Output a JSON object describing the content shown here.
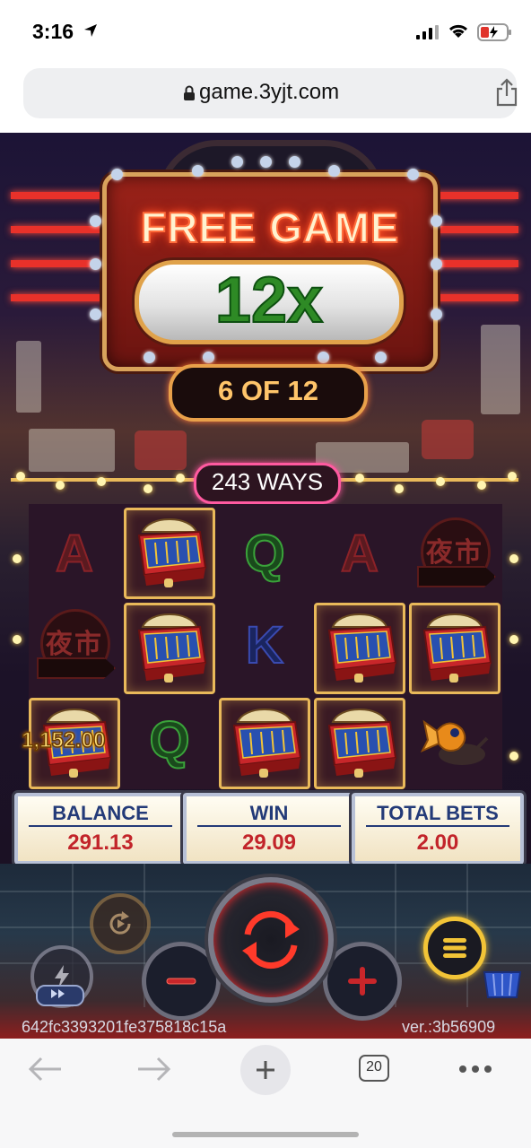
{
  "status_bar": {
    "time": "3:16",
    "icons": [
      "location-arrow-icon",
      "cellular-signal-icon",
      "wifi-icon",
      "battery-charging-icon"
    ]
  },
  "browser": {
    "url": "game.3yjt.com",
    "icons": [
      "lock-icon",
      "share-icon"
    ],
    "toolbar": {
      "tab_count": "20",
      "icons": [
        "back-arrow-icon",
        "forward-arrow-icon",
        "plus-icon",
        "tabs-icon",
        "more-icon"
      ]
    }
  },
  "game": {
    "banner_title": "FREE GAME",
    "multiplier": "12x",
    "round_progress": "6 OF 12",
    "ways": "243 WAYS",
    "reels": [
      [
        "A",
        "night-market",
        "pinball"
      ],
      [
        "pinball",
        "pinball",
        "Q"
      ],
      [
        "Q",
        "K",
        "pinball"
      ],
      [
        "A",
        "pinball",
        "pinball"
      ],
      [
        "night-market",
        "pinball",
        "fish"
      ]
    ],
    "night_market_text": "夜市",
    "highlighted_payout": "1,152.00",
    "panels": {
      "balance_label": "BALANCE",
      "balance_value": "291.13",
      "win_label": "WIN",
      "win_value": "29.09",
      "total_bets_label": "TOTAL BETS",
      "total_bets_value": "2.00"
    },
    "session_id": "642fc3393201fe375818c15a",
    "version": "ver.:3b56909",
    "colors": {
      "accent_gold": "#e9b95a",
      "neon_red": "#ff4a3a",
      "multiplier_green": "#2e8a25",
      "panel_text": "#233a78",
      "value_red": "#c2242a"
    }
  }
}
